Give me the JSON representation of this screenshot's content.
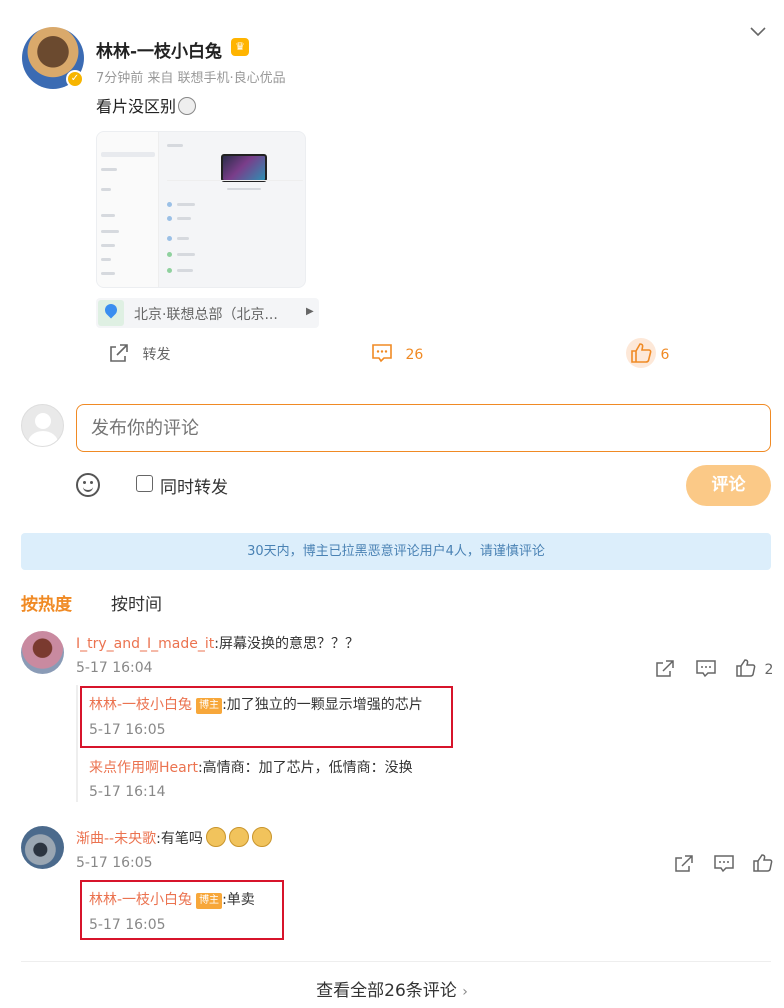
{
  "post": {
    "author": "林林-一枝小白兔",
    "meta": "7分钟前  来自 联想手机·良心优品",
    "text": "看片没区别",
    "location": "北京·联想总部（北京...",
    "actions": {
      "repost_label": "转发",
      "comment_count": "26",
      "like_count": "6"
    }
  },
  "composer": {
    "placeholder": "发布你的评论",
    "repost_label": "同时转发",
    "submit_label": "评论"
  },
  "notice": "30天内，博主已拉黑恶意评论用户4人，请谨慎评论",
  "sort": {
    "hot": "按热度",
    "time": "按时间"
  },
  "comments": [
    {
      "user": "I_try_and_I_made_it",
      "text": ":屏幕没换的意思？？？",
      "time": "5-17 16:04",
      "likes": "2",
      "replies": [
        {
          "user": "林林-一枝小白兔",
          "badge": "博主",
          "text": ":加了独立的一颗显示增强的芯片",
          "time": "5-17 16:05",
          "highlighted": true
        },
        {
          "user": "来点作用啊Heart",
          "text": ":高情商：加了芯片，低情商：没换",
          "time": "5-17 16:14"
        }
      ]
    },
    {
      "user": "渐曲--未央歌",
      "text": ":有笔吗",
      "time": "5-17 16:05",
      "replies": [
        {
          "user": "林林-一枝小白兔",
          "badge": "博主",
          "text": ":单卖",
          "time": "5-17 16:05",
          "highlighted": true
        }
      ]
    }
  ],
  "footer": {
    "view_all": "查看全部26条评论 "
  },
  "colors": {
    "accent": "#f08a24",
    "username": "#eb7350",
    "highlight_border": "#d7142b",
    "notice_bg": "#dceefb"
  }
}
